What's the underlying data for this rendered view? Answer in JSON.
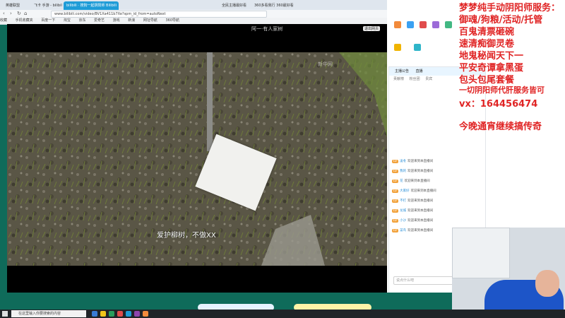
{
  "browser": {
    "tabs": [
      "英雄联盟",
      "飞卡 手游 - bilibili",
      "bilibili · 搜狗一起阴阳师 Bilibili",
      "全民主播最好看",
      "360多看我行 360最好看"
    ],
    "url": "www.bilibili.com/video/BV1Xa411b7Xe?spm_id_from=autoNext",
    "bookmarks": [
      "收藏",
      "手机收藏夹",
      "百度一下",
      "淘宝",
      "京东",
      "爱奇艺",
      "游戏",
      "新浪",
      "网址导航",
      "360导航"
    ]
  },
  "video": {
    "title": "阿一·有人家树",
    "fullscreen_label": "退出网页",
    "subtitle": "爱护柳树，不做XX",
    "watermark": "新华网"
  },
  "chat": {
    "tabs": [
      "主播公告",
      "直播"
    ],
    "subtabs": [
      "贡献榜",
      "粉丝团",
      "贵宾"
    ],
    "lines": [
      {
        "badge": "LV",
        "nick": "凌冬",
        "text": "欢迎来到本直播间"
      },
      {
        "badge": "LV",
        "nick": "我的",
        "text": "欢迎来到本直播间"
      },
      {
        "badge": "LV",
        "nick": "花",
        "text": "欢迎来到本直播间"
      },
      {
        "badge": "LV",
        "nick": "大家好",
        "text": "欢迎来到本直播间"
      },
      {
        "badge": "LV",
        "nick": "不打",
        "text": "欢迎来到本直播间"
      },
      {
        "badge": "LV",
        "nick": "龙城",
        "text": "欢迎来到本直播间"
      },
      {
        "badge": "LV",
        "nick": "小沙",
        "text": "欢迎来到本直播间"
      },
      {
        "badge": "LV",
        "nick": "菜鸟",
        "text": "欢迎来到本直播间"
      }
    ],
    "input_placeholder": "说点什么吧",
    "send_label": "发送"
  },
  "overlay": {
    "lines": [
      "梦梦纯手动阴阳师服务：",
      "御魂/狗粮/活动/托管",
      "百鬼清票砸碗",
      "速清痴御灵卷",
      "地鬼秘闻天下一",
      "平安奇谭拿黑蛋",
      "包头包尾套餐",
      "一切阴阳师代肝服务皆可",
      "vx：164456474",
      "今晚通宵继续搞传奇"
    ]
  },
  "taskbar": {
    "search_placeholder": "在这里输入你要搜索的内容"
  },
  "colors": {
    "accent": "#1e9cd7",
    "overlay_text": "#e02424",
    "bg": "#0f6b5a"
  }
}
